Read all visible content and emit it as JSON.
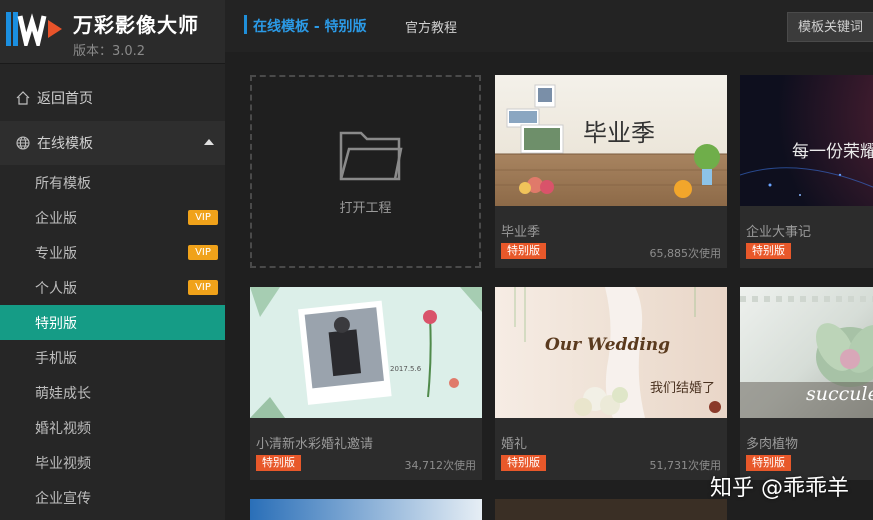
{
  "app": {
    "name": "万彩影像大师",
    "version": "版本：3.0.2"
  },
  "sidebar": {
    "home": "返回首页",
    "section": "在线模板",
    "items": [
      {
        "label": "所有模板",
        "vip": ""
      },
      {
        "label": "企业版",
        "vip": "VIP"
      },
      {
        "label": "专业版",
        "vip": "VIP"
      },
      {
        "label": "个人版",
        "vip": "VIP"
      },
      {
        "label": "特别版",
        "vip": ""
      },
      {
        "label": "手机版",
        "vip": ""
      },
      {
        "label": "萌娃成长",
        "vip": ""
      },
      {
        "label": "婚礼视频",
        "vip": ""
      },
      {
        "label": "毕业视频",
        "vip": ""
      },
      {
        "label": "企业宣传",
        "vip": ""
      }
    ],
    "active_index": 4
  },
  "header": {
    "breadcrumb": "在线模板 - 特别版",
    "tutorial": "官方教程",
    "search_placeholder": "模板关键词"
  },
  "open_project": {
    "label": "打开工程"
  },
  "cards": [
    {
      "title": "毕业季",
      "badge": "特别版",
      "usage": "65,885次使用",
      "thumb_text": "毕业季"
    },
    {
      "title": "企业大事记",
      "badge": "特别版",
      "usage": "",
      "thumb_text": "每一份荣耀"
    },
    {
      "title": "小清新水彩婚礼邀请",
      "badge": "特别版",
      "usage": "34,712次使用",
      "thumb_text": "2017.5.6"
    },
    {
      "title": "婚礼",
      "badge": "特别版",
      "usage": "51,731次使用",
      "thumb_text": "Our Wedding",
      "thumb_text2": "我们结婚了"
    },
    {
      "title": "多肉植物",
      "badge": "特别版",
      "usage": "",
      "thumb_text": "succulent"
    }
  ],
  "watermark": "知乎 @乖乖羊",
  "colors": {
    "accent": "#159c86",
    "vip": "#f0a21a",
    "badge": "#e8582a",
    "link": "#2b9ae6"
  }
}
